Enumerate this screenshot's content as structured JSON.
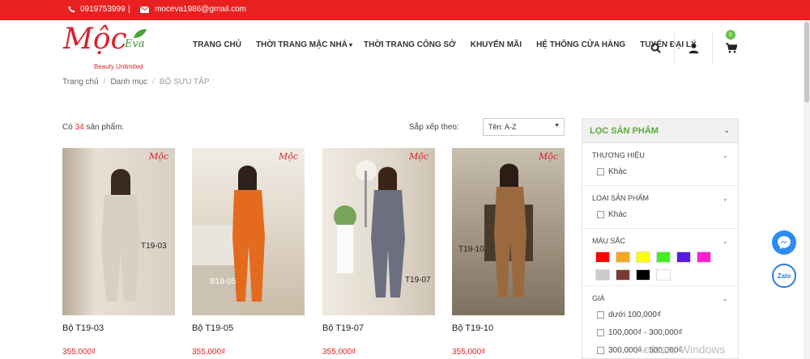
{
  "topbar": {
    "phone": "0919753999",
    "separator": "|",
    "email": "moceva1986@gmail.com"
  },
  "logo": {
    "brand": "Mộc",
    "eva": "Eva",
    "tagline": "Beauty Unlimited"
  },
  "nav": [
    {
      "label": "TRANG CHỦ"
    },
    {
      "label": "THỜI TRANG MẶC NHÀ",
      "caret": "▾"
    },
    {
      "label": "THỜI TRANG CÔNG SỞ"
    },
    {
      "label": "KHUYẾN MÃI"
    },
    {
      "label": "HỆ THỐNG CỬA HÀNG"
    },
    {
      "label": "TUYỂN ĐẠI LÝ"
    }
  ],
  "header_icons": [
    "search-icon",
    "user-icon",
    "cart-icon"
  ],
  "cart_count": "0",
  "breadcrumb": [
    "Trang chủ",
    "Danh mục",
    "BỘ SƯU TẬP"
  ],
  "listing": {
    "count_prefix": "Có",
    "count": "34",
    "count_suffix": "sản phẩm.",
    "sort_label": "Sắp xếp theo:",
    "sort_value": "Tên: A-Z"
  },
  "products": [
    {
      "name": "Bộ T19-03",
      "price": "355,000₫",
      "code": "T19-03",
      "mini_logo": "Mộc",
      "color": "#cfc7b8",
      "outfit": "#d8d2c4"
    },
    {
      "name": "Bộ T19-05",
      "price": "355,000₫",
      "code": "B19-05",
      "mini_logo": "Mộc",
      "color": "#d7d0c2",
      "outfit": "#e46a1e"
    },
    {
      "name": "Bộ T19-07",
      "price": "355,000₫",
      "code": "T19-07",
      "mini_logo": "Mộc",
      "color": "#ddd5c8",
      "outfit": "#6b6f80"
    },
    {
      "name": "Bộ T19-10",
      "price": "355,000₫",
      "code": "T19-10",
      "mini_logo": "Mộc",
      "color": "#a99d8a",
      "outfit": "#9a6a3e"
    }
  ],
  "filter": {
    "title": "LỌC SẢN PHẨM",
    "brand": {
      "title": "THƯƠNG HIỆU",
      "options": [
        "Khác"
      ]
    },
    "type": {
      "title": "LOẠI SẢN PHẨM",
      "options": [
        "Khác"
      ]
    },
    "color": {
      "title": "MÀU SẮC",
      "swatches": [
        "#ff0000",
        "#f5a623",
        "#ffff00",
        "#44ee22",
        "#5a1be0",
        "#ff1fd0",
        "#cccccc",
        "#7a3a32",
        "#000000",
        "#ffffff"
      ]
    },
    "price": {
      "title": "GIÁ",
      "options": [
        "dưới 100,000₫",
        "100,000₫ - 300,000₫",
        "300,000₫ - 500,000₫"
      ]
    }
  },
  "watermark": "Activate Windows",
  "zalo_label": "Zalo",
  "colors": {
    "accent": "#e8201f",
    "green": "#5aaa3c"
  }
}
